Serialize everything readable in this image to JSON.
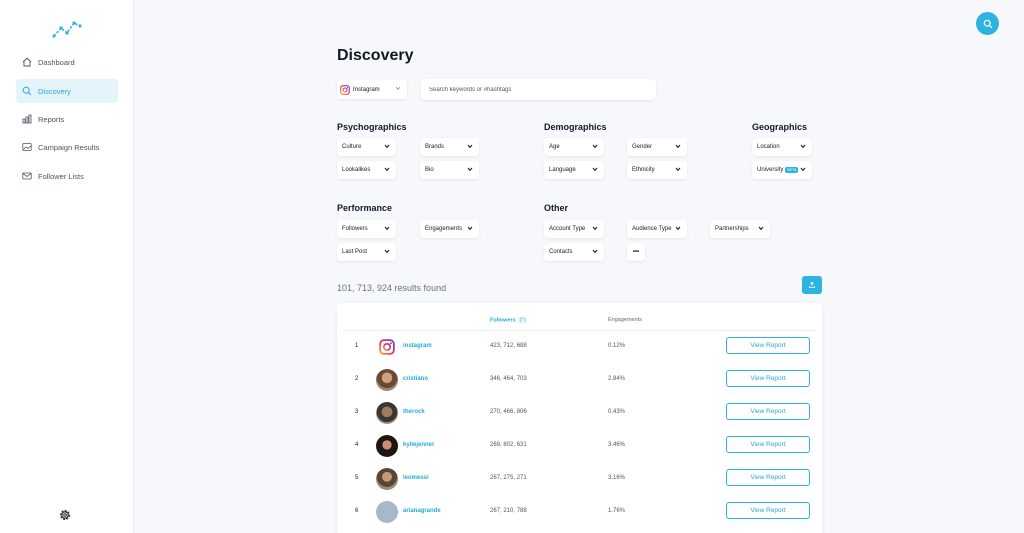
{
  "sidebar": {
    "items": [
      {
        "label": "Dashboard",
        "icon": "home-icon"
      },
      {
        "label": "Discovery",
        "icon": "search-icon",
        "active": true
      },
      {
        "label": "Reports",
        "icon": "bar-chart-icon"
      },
      {
        "label": "Campaign Results",
        "icon": "image-icon"
      },
      {
        "label": "Follower Lists",
        "icon": "mail-icon"
      }
    ],
    "settings_icon": "gear-icon"
  },
  "header": {
    "title": "Discovery",
    "search_fab_icon": "search-icon"
  },
  "search": {
    "platform": "Instagram",
    "placeholder": "Search keywords or #hashtags"
  },
  "filters": {
    "psychographics": {
      "title": "Psychographics",
      "items": [
        "Culture",
        "Brands",
        "Lookalikes",
        "Bio"
      ]
    },
    "demographics": {
      "title": "Demographics",
      "items": [
        "Age",
        "Gender",
        "Language",
        "Ethnicity"
      ]
    },
    "geographics": {
      "title": "Geographics",
      "items": [
        "Location",
        "University"
      ],
      "beta_label": "BETA"
    },
    "performance": {
      "title": "Performance",
      "items": [
        "Followers",
        "Engagements",
        "Last Post"
      ]
    },
    "other": {
      "title": "Other",
      "items": [
        "Account Type",
        "Audience Type",
        "Partnerships",
        "Contacts"
      ],
      "more_label": "•••"
    }
  },
  "results": {
    "count_text": "101, 713, 924 results found",
    "export_icon": "upload-icon",
    "columns": {
      "followers": "Followers",
      "engagements": "Engagements"
    },
    "rows": [
      {
        "rank": "1",
        "handle": "instagram",
        "followers": "423, 712, 688",
        "engagement": "0.12%",
        "action": "View Report"
      },
      {
        "rank": "2",
        "handle": "cristiano",
        "followers": "346, 464, 703",
        "engagement": "2.84%",
        "action": "View Report"
      },
      {
        "rank": "3",
        "handle": "therock",
        "followers": "270, 466, 806",
        "engagement": "0.43%",
        "action": "View Report"
      },
      {
        "rank": "4",
        "handle": "kyliejenner",
        "followers": "269, 802, 631",
        "engagement": "3.46%",
        "action": "View Report"
      },
      {
        "rank": "5",
        "handle": "leomessi",
        "followers": "267, 275, 271",
        "engagement": "3.16%",
        "action": "View Report"
      },
      {
        "rank": "6",
        "handle": "arianagrande",
        "followers": "267, 210, 788",
        "engagement": "1.76%",
        "action": "View Report"
      }
    ]
  },
  "colors": {
    "accent": "#2eb3e1",
    "accent_text": "#27a9d8",
    "background": "#f6f8fb"
  }
}
